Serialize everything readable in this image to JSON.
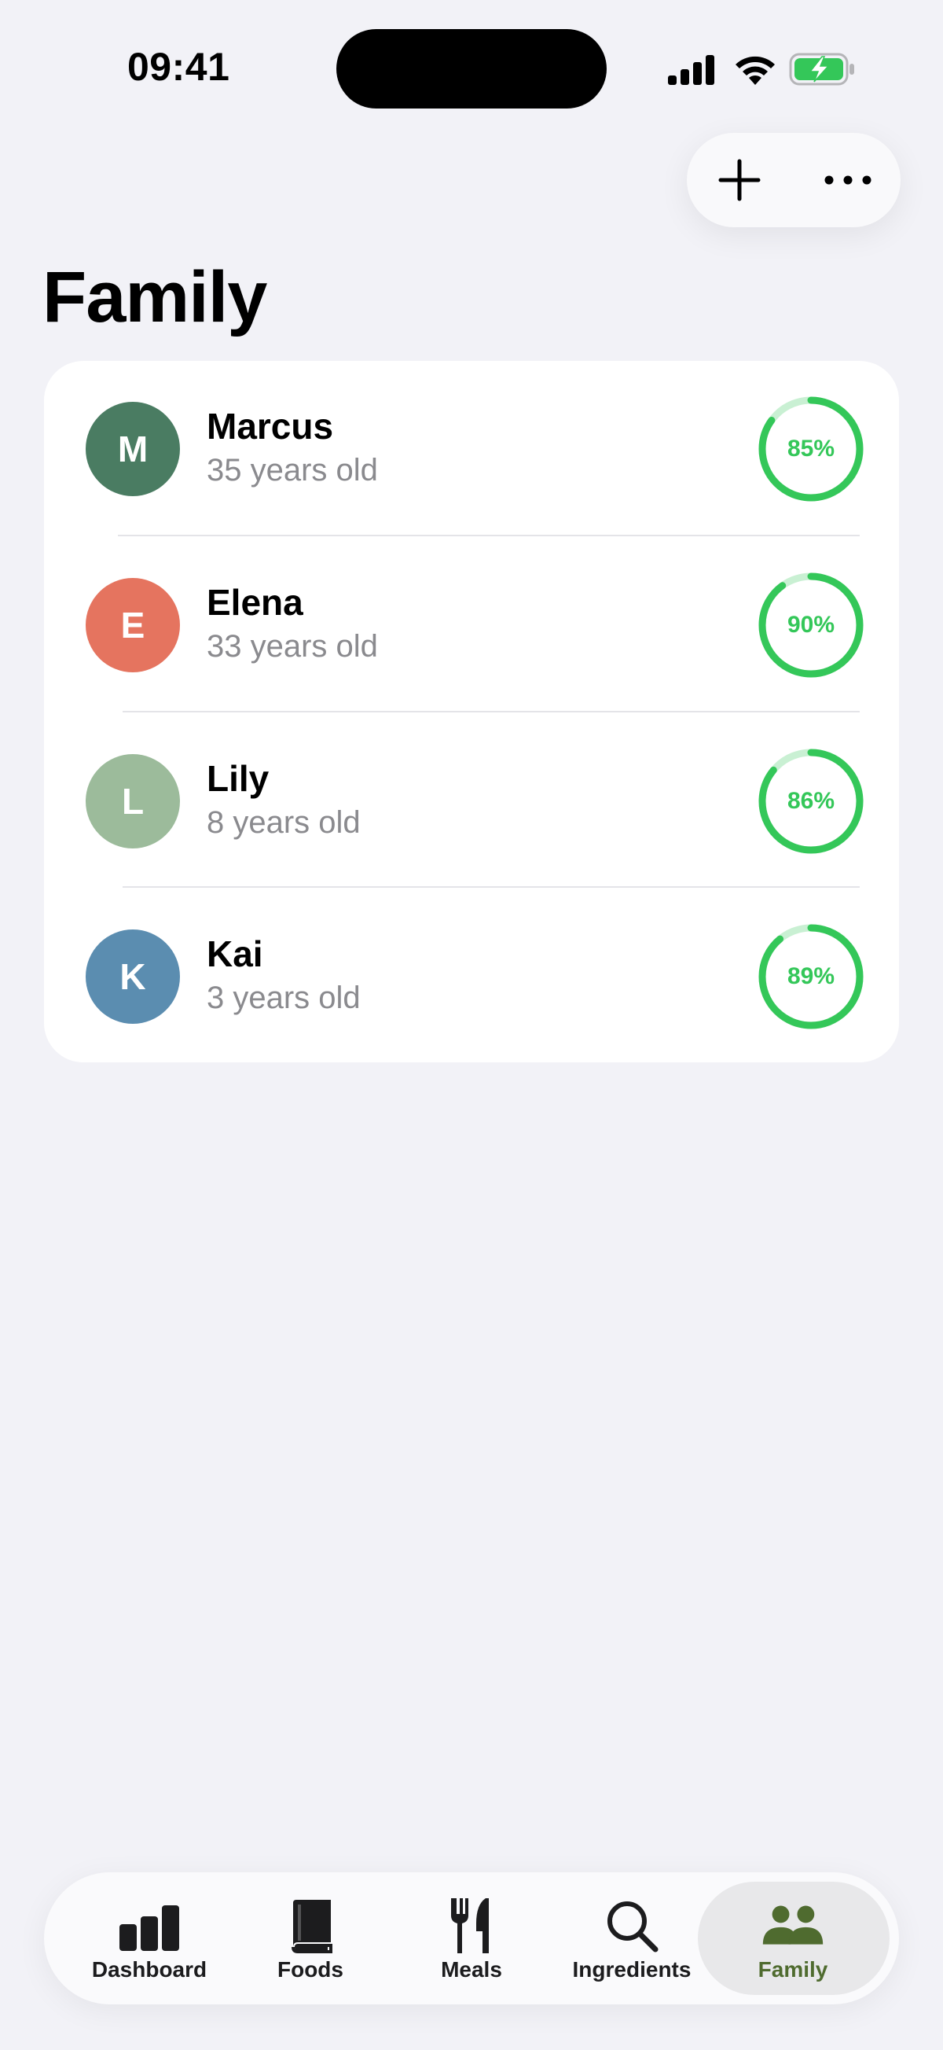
{
  "status_bar": {
    "time": "09:41"
  },
  "header": {
    "title": "Family",
    "add_icon": "plus-icon",
    "more_icon": "ellipsis-icon"
  },
  "members": [
    {
      "initial": "M",
      "name": "Marcus",
      "age": "35 years old",
      "progress_label": "85%",
      "progress": 0.85,
      "color": "#4a7c62"
    },
    {
      "initial": "E",
      "name": "Elena",
      "age": "33 years old",
      "progress_label": "90%",
      "progress": 0.9,
      "color": "#e5745f"
    },
    {
      "initial": "L",
      "name": "Lily",
      "age": "8 years old",
      "progress_label": "86%",
      "progress": 0.86,
      "color": "#9cbb9b"
    },
    {
      "initial": "K",
      "name": "Kai",
      "age": "3 years old",
      "progress_label": "89%",
      "progress": 0.89,
      "color": "#5b8db0"
    }
  ],
  "tabs": [
    {
      "label": "Dashboard",
      "icon": "chart-bar-icon"
    },
    {
      "label": "Foods",
      "icon": "book-icon"
    },
    {
      "label": "Meals",
      "icon": "fork-knife-icon"
    },
    {
      "label": "Ingredients",
      "icon": "search-icon"
    },
    {
      "label": "Family",
      "icon": "people-icon",
      "active": true
    }
  ],
  "colors": {
    "background": "#f2f2f7",
    "ring_progress": "#34c759",
    "ring_track": "#c9f0d3",
    "active_tab": "#4f6b2f"
  }
}
